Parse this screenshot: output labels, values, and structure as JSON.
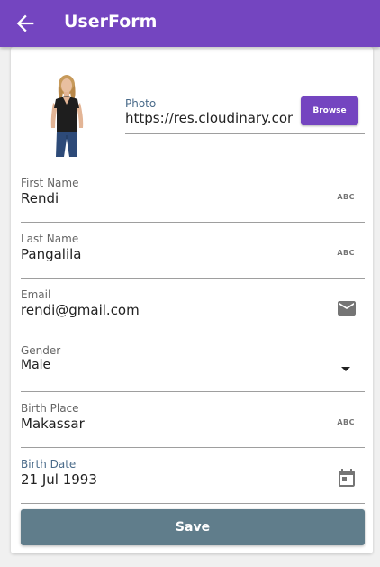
{
  "appbar": {
    "title": "UserForm",
    "back_icon": "arrow-left-icon",
    "color": "#7445c0"
  },
  "photo": {
    "label": "Photo",
    "value": "https://res.cloudinary.com",
    "browse_label": "Browse"
  },
  "fields": {
    "first_name": {
      "label": "First Name",
      "value": "Rendi",
      "icon": "abc-icon",
      "icon_text": "ABC"
    },
    "last_name": {
      "label": "Last Name",
      "value": "Pangalila",
      "icon": "abc-icon",
      "icon_text": "ABC"
    },
    "email": {
      "label": "Email",
      "value": "rendi@gmail.com",
      "icon": "email-icon"
    },
    "gender": {
      "label": "Gender",
      "value": "Male",
      "icon": "dropdown-arrow-icon"
    },
    "birth_place": {
      "label": "Birth Place",
      "value": "Makassar",
      "icon": "abc-icon",
      "icon_text": "ABC"
    },
    "birth_date": {
      "label": "Birth Date",
      "value": "21 Jul 1993",
      "icon": "calendar-icon"
    }
  },
  "save_label": "Save",
  "colors": {
    "primary": "#7445c0",
    "save_button": "#607d8b",
    "focused_label": "#4a6b8a"
  }
}
